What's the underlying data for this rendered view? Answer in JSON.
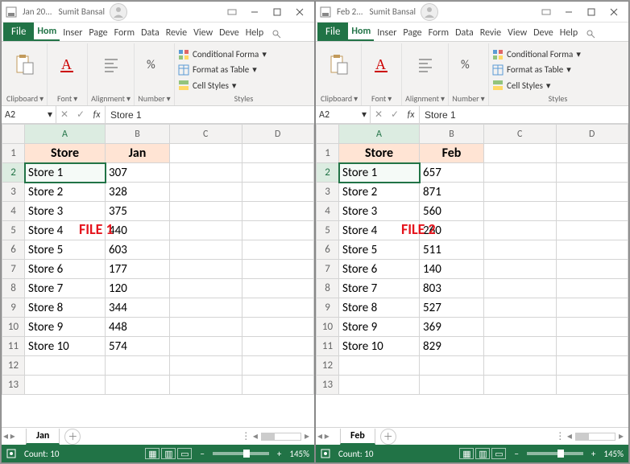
{
  "panes": [
    {
      "id": "file1",
      "titlebar": {
        "filename": "Jan 20...",
        "user": "Sumit Bansal"
      },
      "ribbon_tabs": {
        "file": "File",
        "home": "Hom",
        "insert": "Inser",
        "page": "Page",
        "formulas": "Form",
        "data": "Data",
        "review": "Revie",
        "view": "View",
        "developer": "Deve",
        "help": "Help"
      },
      "ribbon_groups": {
        "clipboard": "Clipboard",
        "font": "Font",
        "alignment": "Alignment",
        "number": "Number",
        "cond_fmt": "Conditional Forma",
        "as_table": "Format as Table",
        "cell_styles": "Cell Styles",
        "styles_label": "Styles"
      },
      "namebox": "A2",
      "formula": "Store 1",
      "overlay_label": "FILE 1",
      "selected": {
        "row": 0,
        "col": 0
      },
      "col_headers": [
        "A",
        "B",
        "C",
        "D"
      ],
      "header_row": [
        "Store",
        "Jan"
      ],
      "data_rows": [
        [
          "Store 1",
          "307"
        ],
        [
          "Store 2",
          "328"
        ],
        [
          "Store 3",
          "375"
        ],
        [
          "Store 4",
          "440"
        ],
        [
          "Store 5",
          "603"
        ],
        [
          "Store 6",
          "177"
        ],
        [
          "Store 7",
          "120"
        ],
        [
          "Store 8",
          "344"
        ],
        [
          "Store 9",
          "448"
        ],
        [
          "Store 10",
          "574"
        ]
      ],
      "sheet_tab": "Jan",
      "status": {
        "count_label": "Count: 10",
        "zoom": "145%"
      }
    },
    {
      "id": "file2",
      "titlebar": {
        "filename": "Feb 2...",
        "user": "Sumit Bansal"
      },
      "ribbon_tabs": {
        "file": "File",
        "home": "Hom",
        "insert": "Inser",
        "page": "Page",
        "formulas": "Form",
        "data": "Data",
        "review": "Revie",
        "view": "View",
        "developer": "Deve",
        "help": "Help"
      },
      "ribbon_groups": {
        "clipboard": "Clipboard",
        "font": "Font",
        "alignment": "Alignment",
        "number": "Number",
        "cond_fmt": "Conditional Forma",
        "as_table": "Format as Table",
        "cell_styles": "Cell Styles",
        "styles_label": "Styles"
      },
      "namebox": "A2",
      "formula": "Store 1",
      "overlay_label": "FILE 2",
      "selected": {
        "row": 0,
        "col": 0
      },
      "col_headers": [
        "A",
        "B",
        "C",
        "D"
      ],
      "header_row": [
        "Store",
        "Feb"
      ],
      "data_rows": [
        [
          "Store 1",
          "657"
        ],
        [
          "Store 2",
          "871"
        ],
        [
          "Store 3",
          "560"
        ],
        [
          "Store 4",
          "260"
        ],
        [
          "Store 5",
          "511"
        ],
        [
          "Store 6",
          "140"
        ],
        [
          "Store 7",
          "803"
        ],
        [
          "Store 8",
          "527"
        ],
        [
          "Store 9",
          "369"
        ],
        [
          "Store 10",
          "829"
        ]
      ],
      "sheet_tab": "Feb",
      "status": {
        "count_label": "Count: 10",
        "zoom": "145%"
      }
    }
  ]
}
